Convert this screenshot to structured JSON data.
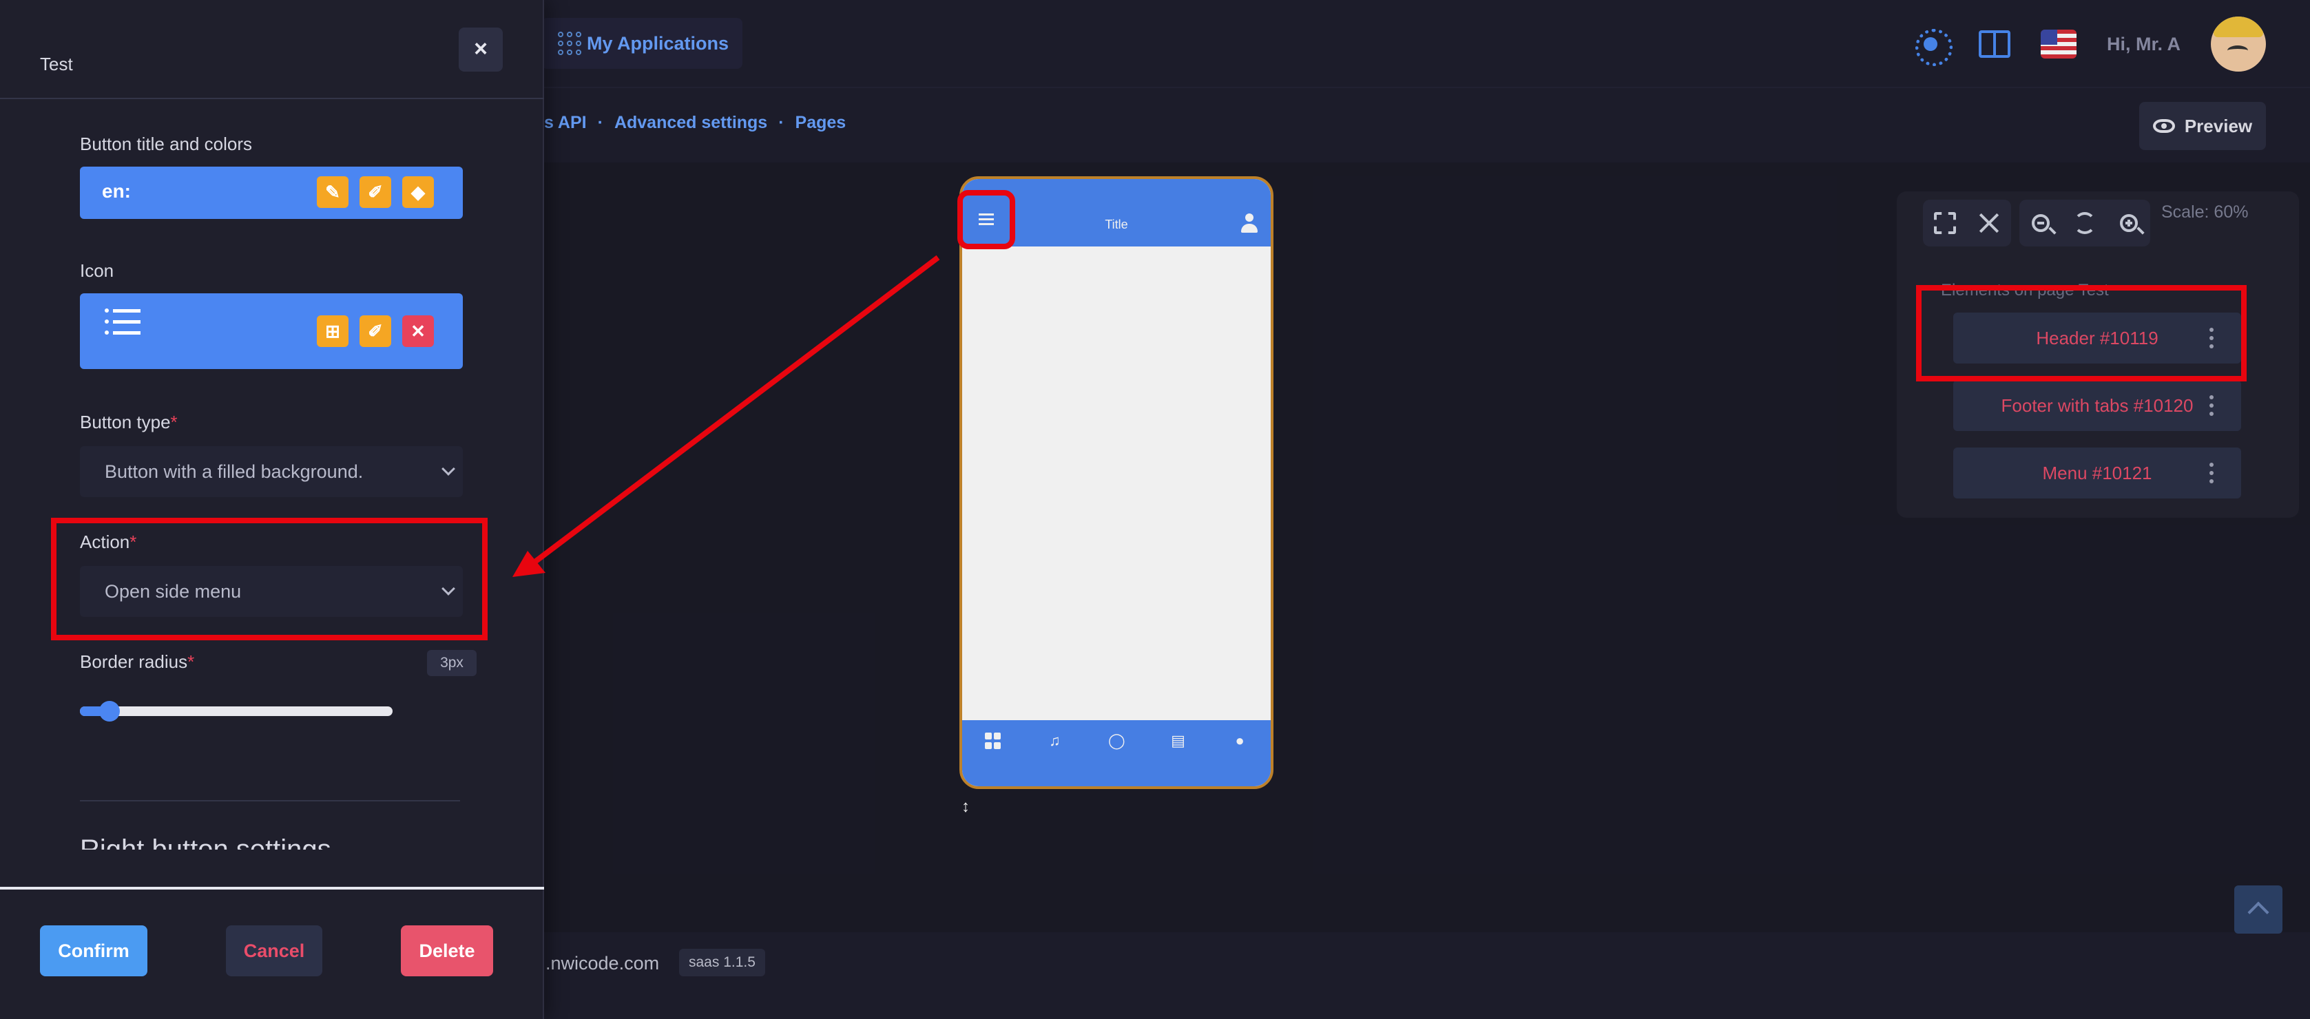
{
  "header": {
    "apps_label": "My Applications",
    "greeting": "Hi, Mr. A"
  },
  "breadcrumb": {
    "items": [
      "s API",
      "Advanced settings",
      "Pages"
    ],
    "separator": "·"
  },
  "preview_label": "Preview",
  "phone": {
    "title": "Title"
  },
  "elements_panel": {
    "scale_label": "Scale: 60%",
    "heading": "Elements on page Test",
    "items": [
      "Header #10119",
      "Footer with tabs #10120",
      "Menu #10121"
    ]
  },
  "footer": {
    "domain": ".nwicode.com",
    "version": "saas 1.1.5"
  },
  "side_panel": {
    "title": "Test",
    "close_label": "×",
    "button_title_label": "Button title and colors",
    "lang_prefix": "en:",
    "icon_label": "Icon",
    "button_type_label": "Button type",
    "button_type_value": "Button with a filled background.",
    "action_label": "Action",
    "action_value": "Open side menu",
    "border_radius_label": "Border radius",
    "border_radius_value": "3px",
    "border_radius_slider_fraction": 0.03,
    "section_title": "Right button settings",
    "required_mark": "*",
    "confirm_label": "Confirm",
    "cancel_label": "Cancel",
    "delete_label": "Delete"
  },
  "colors": {
    "accent": "#4b86f2",
    "danger": "#e8425a",
    "warning": "#f5a623",
    "highlight": "#e8050f"
  }
}
